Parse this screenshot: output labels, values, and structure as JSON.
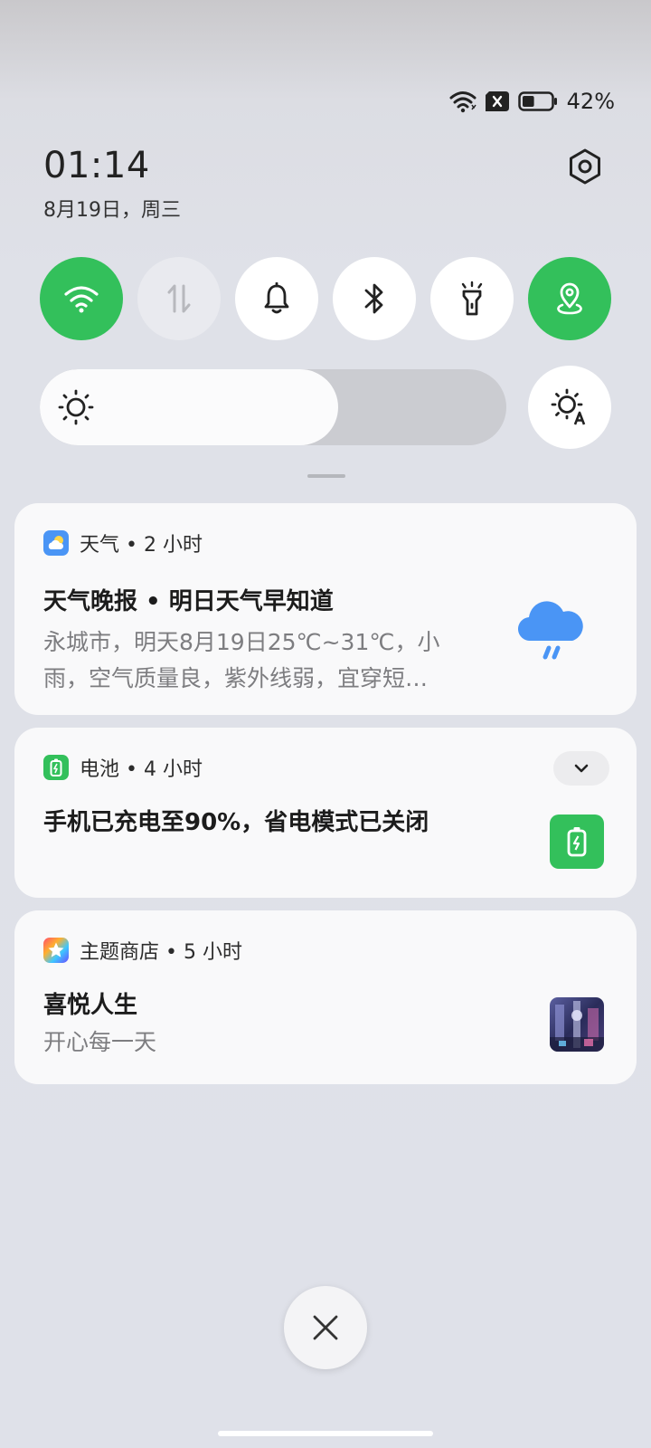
{
  "status": {
    "battery_percent": "42%",
    "battery_level": 0.42
  },
  "header": {
    "time": "01:14",
    "date": "8月19日，周三"
  },
  "quick_settings": [
    {
      "name": "wifi",
      "icon": "wifi-icon",
      "state": "on"
    },
    {
      "name": "mobile-data",
      "icon": "mobile-data-icon",
      "state": "disabled"
    },
    {
      "name": "ring",
      "icon": "bell-icon",
      "state": "off"
    },
    {
      "name": "bluetooth",
      "icon": "bluetooth-icon",
      "state": "off"
    },
    {
      "name": "flashlight",
      "icon": "flashlight-icon",
      "state": "off"
    },
    {
      "name": "location",
      "icon": "location-icon",
      "state": "on"
    }
  ],
  "brightness": {
    "level": 0.64
  },
  "notifications": [
    {
      "app": "天气 • 2 小时",
      "title": "天气晚报 • 明日天气早知道",
      "body": "永城市，明天8月19日25℃~31℃，小雨，空气质量良，紫外线弱，宜穿短…"
    },
    {
      "app": "电池 • 4 小时",
      "title": "手机已充电至90%，省电模式已关闭"
    },
    {
      "app": "主题商店 • 5 小时",
      "title": "喜悦人生",
      "body": "开心每一天"
    }
  ],
  "colors": {
    "accent_green": "#33c05b",
    "weather_blue": "#4a95f5"
  }
}
